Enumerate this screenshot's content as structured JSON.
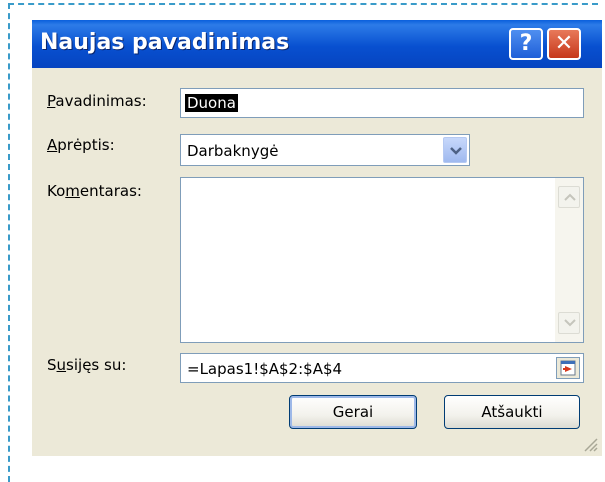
{
  "dialog": {
    "title": "Naujas pavadinimas",
    "help_label": "?",
    "close_label": "✕"
  },
  "fields": {
    "name": {
      "access_key": "P",
      "rest": "avadinimas:",
      "value": "Duona"
    },
    "scope": {
      "access_key": "A",
      "rest": "prėptis:",
      "value": "Darbaknygė"
    },
    "comment": {
      "before": "Ko",
      "access_key": "m",
      "after": "entaras:",
      "value": ""
    },
    "refers_to": {
      "before": "S",
      "access_key": "u",
      "after": "sijęs su:",
      "value": "=Lapas1!$A$2:$A$4"
    }
  },
  "buttons": {
    "ok": "Gerai",
    "cancel": "Atšaukti"
  },
  "colors": {
    "titlebar": "#0850d0",
    "dialog_bg": "#ece9d8",
    "dashed_border": "#3a9bc9"
  }
}
